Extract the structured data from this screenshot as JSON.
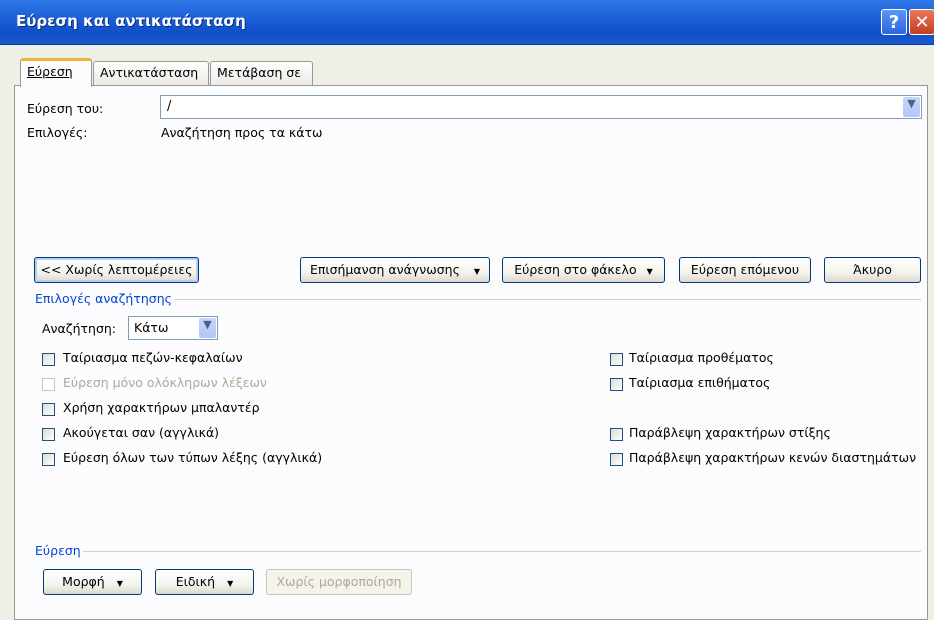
{
  "window": {
    "title": "Εύρεση και αντικατάσταση",
    "help_glyph": "?",
    "close_glyph": "✕"
  },
  "tabs": [
    {
      "label": "Εύρεση",
      "active": true
    },
    {
      "label": "Αντικατάσταση",
      "active": false
    },
    {
      "label": "Μετάβαση σε",
      "active": false
    }
  ],
  "find": {
    "label": "Εύρεση του:",
    "value": "/",
    "options_label": "Επιλογές:",
    "options_value": "Αναζήτηση προς τα κάτω"
  },
  "buttons": {
    "less": "<< Χωρίς λεπτομέρειες",
    "reading_highlight": "Επισήμανση ανάγνωσης",
    "find_in": "Εύρεση στο φάκελο",
    "find_next": "Εύρεση επόμενου",
    "cancel": "Άκυρο",
    "format": "Μορφή",
    "special": "Ειδική",
    "no_formatting": "Χωρίς μορφοποίηση"
  },
  "search_options": {
    "group_title": "Επιλογές αναζήτησης",
    "search_label": "Αναζήτηση:",
    "search_value": "Κάτω",
    "left": [
      {
        "label": "Ταίριασμα πεζών-κεφαλαίων",
        "checked": false,
        "enabled": true
      },
      {
        "label": "Εύρεση μόνο ολόκληρων λέξεων",
        "checked": false,
        "enabled": false
      },
      {
        "label": "Χρήση χαρακτήρων μπαλαντέρ",
        "checked": false,
        "enabled": true
      },
      {
        "label": "Ακούγεται σαν (αγγλικά)",
        "checked": false,
        "enabled": true
      },
      {
        "label": "Εύρεση όλων των τύπων λέξης (αγγλικά)",
        "checked": false,
        "enabled": true
      }
    ],
    "right": [
      {
        "label": "Ταίριασμα προθέματος",
        "checked": false
      },
      {
        "label": "Ταίριασμα επιθήματος",
        "checked": false
      },
      {
        "label": "Παράβλεψη χαρακτήρων στίξης",
        "checked": false
      },
      {
        "label": "Παράβλεψη χαρακτήρων κενών διαστημάτων",
        "checked": false
      }
    ]
  },
  "find_group": {
    "title": "Εύρεση"
  },
  "icons": {
    "dropdown_arrow": "▼",
    "combo_arrow": "⌄"
  }
}
